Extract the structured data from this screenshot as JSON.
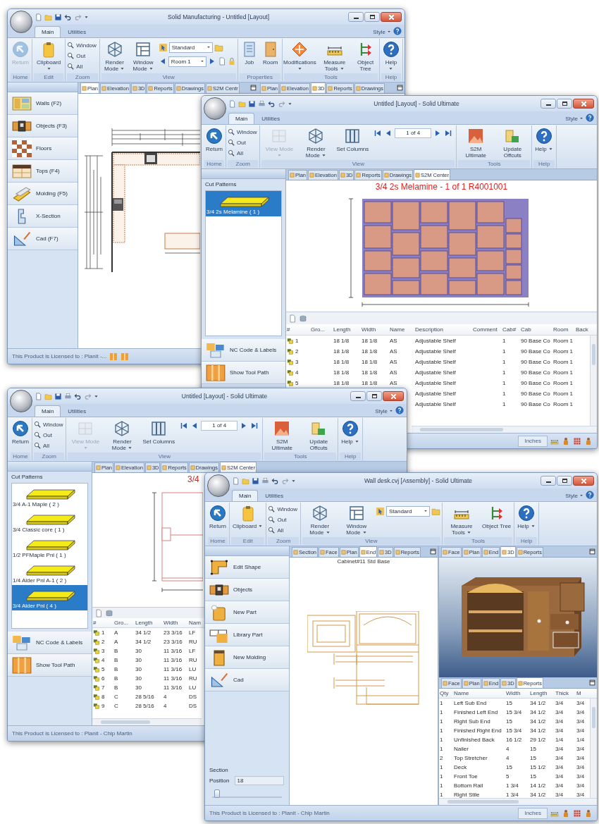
{
  "windows": [
    {
      "kind": "plan",
      "title": "Solid Manufacturing - Untitled [Layout]",
      "ribbon_tabs": [
        {
          "label": "Main",
          "selected": true
        },
        {
          "label": "Utilities",
          "selected": false
        }
      ],
      "style_menu": "Style",
      "ribbon_groups": [
        {
          "label": "Home",
          "items": [
            {
              "kind": "large",
              "label": "Return",
              "dropdown": false,
              "disabled": true
            }
          ]
        },
        {
          "label": "Edit",
          "items": [
            {
              "kind": "large",
              "label": "Clipboard",
              "dropdown": true,
              "disabled": false
            }
          ]
        },
        {
          "label": "Zoom",
          "items": [
            {
              "kind": "stack",
              "labels": [
                "Window",
                "Out",
                "All"
              ]
            }
          ]
        },
        {
          "label": "View",
          "items": [
            {
              "kind": "large",
              "label": "Render Mode",
              "dropdown": true,
              "disabled": false
            },
            {
              "kind": "large",
              "label": "Window Mode",
              "dropdown": true,
              "disabled": false
            },
            {
              "kind": "combos",
              "combos": [
                {
                  "value": "Standard",
                  "arrows": false
                },
                {
                  "value": "Room 1",
                  "arrows": true
                }
              ]
            }
          ]
        },
        {
          "label": "Properties",
          "items": [
            {
              "kind": "large",
              "label": "Job",
              "dropdown": false,
              "disabled": false
            },
            {
              "kind": "large",
              "label": "Room",
              "dropdown": false,
              "disabled": false
            }
          ]
        },
        {
          "label": "Tools",
          "items": [
            {
              "kind": "large",
              "label": "Modifications",
              "dropdown": true,
              "disabled": false
            },
            {
              "kind": "large",
              "label": "Measure Tools",
              "dropdown": true,
              "disabled": false
            },
            {
              "kind": "large",
              "label": "Object Tree",
              "dropdown": false,
              "disabled": false
            }
          ]
        },
        {
          "label": "Help",
          "items": [
            {
              "kind": "large",
              "label": "Help",
              "dropdown": true,
              "disabled": false
            }
          ]
        }
      ],
      "tools": [
        "Walls (F2)",
        "Objects (F3)",
        "Floors",
        "Tops (F4)",
        "Molding (F5)",
        "X-Section",
        "Cad (F7)"
      ],
      "panes": [
        {
          "tabs": [
            {
              "label": "Plan",
              "selected": true
            },
            {
              "label": "Elevation",
              "selected": false
            },
            {
              "label": "3D",
              "selected": false
            },
            {
              "label": "Reports",
              "selected": false
            },
            {
              "label": "Drawings",
              "selected": false
            },
            {
              "label": "S2M Centr",
              "selected": false
            }
          ]
        },
        {
          "tabs": [
            {
              "label": "Plan",
              "selected": false
            },
            {
              "label": "Elevation",
              "selected": false
            },
            {
              "label": "3D",
              "selected": true
            },
            {
              "label": "Reports",
              "selected": false
            },
            {
              "label": "Drawings",
              "selected": false
            }
          ]
        }
      ],
      "status": {
        "text": "This Product is Licensed to : Planit -..."
      }
    },
    {
      "kind": "cut",
      "title": "Untitled [Layout] - Solid Ultimate",
      "ribbon_tabs": [
        {
          "label": "Main",
          "selected": true
        },
        {
          "label": "Utilities",
          "selected": false
        }
      ],
      "style_menu": "Style",
      "ribbon_groups": [
        {
          "label": "Home",
          "items": [
            {
              "kind": "large",
              "label": "Return",
              "dropdown": false,
              "disabled": false
            }
          ]
        },
        {
          "label": "Zoom",
          "items": [
            {
              "kind": "stack",
              "labels": [
                "Window",
                "Out",
                "All"
              ]
            }
          ]
        },
        {
          "label": "View",
          "items": [
            {
              "kind": "large",
              "label": "View Mode",
              "dropdown": true,
              "disabled": true
            },
            {
              "kind": "large",
              "label": "Render Mode",
              "dropdown": true,
              "disabled": false
            },
            {
              "kind": "large",
              "label": "Set Columns",
              "dropdown": false,
              "disabled": false
            },
            {
              "kind": "pager",
              "value": "1 of 4"
            }
          ]
        },
        {
          "label": "Tools",
          "items": [
            {
              "kind": "large",
              "label": "S2M Ultimate",
              "dropdown": false,
              "disabled": false
            },
            {
              "kind": "large",
              "label": "Update Offcuts",
              "dropdown": false,
              "disabled": false
            }
          ]
        },
        {
          "label": "Help",
          "items": [
            {
              "kind": "large",
              "label": "Help",
              "dropdown": true,
              "disabled": false
            }
          ]
        }
      ],
      "patterns_title": "Cut Patterns",
      "patterns": [
        {
          "label": "3/4 2s Melamine ( 1 )",
          "selected": true
        }
      ],
      "tools": [
        "NC Code & Labels",
        "Show Tool Path"
      ],
      "tabs": [
        {
          "label": "Plan",
          "selected": false
        },
        {
          "label": "Elevation",
          "selected": false
        },
        {
          "label": "3D",
          "selected": false
        },
        {
          "label": "Reports",
          "selected": false
        },
        {
          "label": "Drawings",
          "selected": false
        },
        {
          "label": "S2M Center",
          "selected": true
        }
      ],
      "heading": "3/4 2s Melamine - 1 of 1 R4001001",
      "table": {
        "columns": [
          "#",
          "Gro...",
          "Length",
          "Width",
          "Name",
          "Description",
          "Comment",
          "Cab#",
          "Cab",
          "Room",
          "Back"
        ],
        "rows": [
          [
            "1",
            null,
            "18 1/8",
            "18 1/8",
            "AS",
            "Adjustable Shelf",
            null,
            "1",
            "90 Base Co",
            "Room 1",
            null
          ],
          [
            "2",
            null,
            "18 1/8",
            "18 1/8",
            "AS",
            "Adjustable Shelf",
            null,
            "1",
            "90 Base Co",
            "Room 1",
            null
          ],
          [
            "3",
            null,
            "18 1/8",
            "18 1/8",
            "AS",
            "Adjustable Shelf",
            null,
            "1",
            "90 Base Co",
            "Room 1",
            null
          ],
          [
            "4",
            null,
            "18 1/8",
            "18 1/8",
            "AS",
            "Adjustable Shelf",
            null,
            "1",
            "90 Base Co",
            "Room 1",
            null
          ],
          [
            "5",
            null,
            "18 1/8",
            "18 1/8",
            "AS",
            "Adjustable Shelf",
            null,
            "1",
            "90 Base Co",
            "Room 1",
            null
          ],
          [
            null,
            null,
            null,
            null,
            null,
            "Adjustable Shelf",
            null,
            "1",
            "90 Base Co",
            "Room 1",
            null
          ],
          [
            null,
            null,
            null,
            null,
            null,
            "Adjustable Shelf",
            null,
            "1",
            "90 Base Co",
            "Room 1",
            null
          ]
        ]
      },
      "status": {
        "units": "Inches"
      }
    },
    {
      "kind": "cut",
      "title": "Untitled [Layout] - Solid Ultimate",
      "ribbon_tabs": [
        {
          "label": "Main",
          "selected": true
        },
        {
          "label": "Utilities",
          "selected": false
        }
      ],
      "style_menu": "Style",
      "ribbon_groups": [
        {
          "label": "Home",
          "items": [
            {
              "kind": "large",
              "label": "Return",
              "dropdown": false,
              "disabled": false
            }
          ]
        },
        {
          "label": "Zoom",
          "items": [
            {
              "kind": "stack",
              "labels": [
                "Window",
                "Out",
                "All"
              ]
            }
          ]
        },
        {
          "label": "View",
          "items": [
            {
              "kind": "large",
              "label": "View Mode",
              "dropdown": true,
              "disabled": true
            },
            {
              "kind": "large",
              "label": "Render Mode",
              "dropdown": true,
              "disabled": false
            },
            {
              "kind": "large",
              "label": "Set Columns",
              "dropdown": false,
              "disabled": false
            },
            {
              "kind": "pager",
              "value": "1 of 4"
            }
          ]
        },
        {
          "label": "Tools",
          "items": [
            {
              "kind": "large",
              "label": "S2M Ultimate",
              "dropdown": false,
              "disabled": false
            },
            {
              "kind": "large",
              "label": "Update Offcuts",
              "dropdown": false,
              "disabled": false
            }
          ]
        },
        {
          "label": "Help",
          "items": [
            {
              "kind": "large",
              "label": "Help",
              "dropdown": true,
              "disabled": false
            }
          ]
        }
      ],
      "patterns_title": "Cut Patterns",
      "patterns": [
        {
          "label": "3/4 A-1 Maple ( 2 )",
          "selected": false
        },
        {
          "label": "3/4 Classic core ( 1 )",
          "selected": false
        },
        {
          "label": "1/2 PFMaple Pnl ( 1 )",
          "selected": false
        },
        {
          "label": "1/4 Alder Pnl A-1 ( 2 )",
          "selected": false
        },
        {
          "label": "3/4 Alder Pnl ( 4 )",
          "selected": true
        }
      ],
      "tools": [
        "NC Code & Labels",
        "Show Tool Path"
      ],
      "tabs": [
        {
          "label": "Plan",
          "selected": false
        },
        {
          "label": "Elevation",
          "selected": false
        },
        {
          "label": "3D",
          "selected": false
        },
        {
          "label": "Reports",
          "selected": false
        },
        {
          "label": "Drawings",
          "selected": false
        },
        {
          "label": "S2M Center",
          "selected": true
        }
      ],
      "heading": "3/4",
      "table": {
        "columns": [
          "#",
          "Gro...",
          "Length",
          "Width",
          "Nam"
        ],
        "rows": [
          [
            "1",
            "A",
            "34 1/2",
            "23 3/16",
            "LF"
          ],
          [
            "2",
            "A",
            "34 1/2",
            "23 3/16",
            "RU"
          ],
          [
            "3",
            "B",
            "30",
            "11 3/16",
            "LF"
          ],
          [
            "4",
            "B",
            "30",
            "11 3/16",
            "RU"
          ],
          [
            "5",
            "B",
            "30",
            "11 3/16",
            "LU"
          ],
          [
            "6",
            "B",
            "30",
            "11 3/16",
            "RU"
          ],
          [
            "7",
            "B",
            "30",
            "11 3/16",
            "LU"
          ],
          [
            "8",
            "C",
            "28 5/16",
            "4",
            "DS"
          ],
          [
            "9",
            "C",
            "28 5/16",
            "4",
            "DS"
          ]
        ]
      },
      "status": {
        "text": "This Product is Licensed to : Planit - Chip Martin"
      }
    },
    {
      "kind": "assembly",
      "title": "Wall desk.cvj [Assembly] - Solid Ultimate",
      "ribbon_tabs": [
        {
          "label": "Main",
          "selected": true
        },
        {
          "label": "Utilities",
          "selected": false
        }
      ],
      "style_menu": "Style",
      "ribbon_groups": [
        {
          "label": "Home",
          "items": [
            {
              "kind": "large",
              "label": "Return",
              "dropdown": false,
              "disabled": false
            }
          ]
        },
        {
          "label": "Edit",
          "items": [
            {
              "kind": "large",
              "label": "Clipboard",
              "dropdown": true,
              "disabled": false
            }
          ]
        },
        {
          "label": "Zoom",
          "items": [
            {
              "kind": "stack",
              "labels": [
                "Window",
                "Out",
                "All"
              ]
            }
          ]
        },
        {
          "label": "View",
          "items": [
            {
              "kind": "large",
              "label": "Render Mode",
              "dropdown": true,
              "disabled": false
            },
            {
              "kind": "large",
              "label": "Window Mode",
              "dropdown": true,
              "disabled": false
            },
            {
              "kind": "combos",
              "combos": [
                {
                  "value": "Standard",
                  "arrows": false
                }
              ]
            }
          ]
        },
        {
          "label": "Tools",
          "items": [
            {
              "kind": "large",
              "label": "Measure Tools",
              "dropdown": true,
              "disabled": false
            },
            {
              "kind": "large",
              "label": "Object Tree",
              "dropdown": false,
              "disabled": false
            }
          ]
        },
        {
          "label": "Help",
          "items": [
            {
              "kind": "large",
              "label": "Help",
              "dropdown": true,
              "disabled": false
            }
          ]
        }
      ],
      "tools": [
        "Edit Shape",
        "Objects",
        "New Part",
        "Library Part",
        "New Molding",
        "Cad"
      ],
      "section": {
        "title": "Section",
        "label": "Position",
        "value": "18",
        "level": 0.03
      },
      "panes": [
        {
          "tabs": [
            {
              "label": "Section",
              "selected": false
            },
            {
              "label": "Face",
              "selected": false
            },
            {
              "label": "Plan",
              "selected": false
            },
            {
              "label": "End",
              "selected": true
            },
            {
              "label": "3D",
              "selected": false
            },
            {
              "label": "Reports",
              "selected": false
            }
          ],
          "caption": "Cabinet#11 Std Base"
        },
        {
          "tabs": [
            {
              "label": "Face",
              "selected": false
            },
            {
              "label": "Plan",
              "selected": false
            },
            {
              "label": "End",
              "selected": false
            },
            {
              "label": "3D",
              "selected": true
            },
            {
              "label": "Reports",
              "selected": false
            }
          ]
        },
        {
          "tabs": [
            {
              "label": "Face",
              "selected": false
            },
            {
              "label": "Plan",
              "selected": false
            },
            {
              "label": "End",
              "selected": false
            },
            {
              "label": "3D",
              "selected": false
            },
            {
              "label": "Reports",
              "selected": true
            }
          ],
          "table": {
            "columns": [
              "Qty",
              "Name",
              "Width",
              "Length",
              "Thick",
              "M"
            ],
            "rows": [
              [
                "1",
                "Left Sub End",
                "15",
                "34 1/2",
                "3/4",
                "3/4"
              ],
              [
                "1",
                "Finished Left End",
                "15 3/4",
                "34 1/2",
                "3/4",
                "3/4"
              ],
              [
                "1",
                "Right Sub End",
                "15",
                "34 1/2",
                "3/4",
                "3/4"
              ],
              [
                "1",
                "Finished Right End",
                "15 3/4",
                "34 1/2",
                "3/4",
                "3/4"
              ],
              [
                "1",
                "Unfinished Back",
                "16 1/2",
                "29 1/2",
                "1/4",
                "1/4"
              ],
              [
                "1",
                "Nailer",
                "4",
                "15",
                "3/4",
                "3/4"
              ],
              [
                "2",
                "Top Stretcher",
                "4",
                "15",
                "3/4",
                "3/4"
              ],
              [
                "1",
                "Deck",
                "15",
                "15 1/2",
                "3/4",
                "3/4"
              ],
              [
                "1",
                "Front Toe",
                "5",
                "15",
                "3/4",
                "3/4"
              ],
              [
                "1",
                "Bottom Rail",
                "1 3/4",
                "14 1/2",
                "3/4",
                "3/4"
              ],
              [
                "1",
                "Right Stile",
                "1 3/4",
                "34 1/2",
                "3/4",
                "3/4"
              ]
            ]
          }
        }
      ],
      "status": {
        "text": "This Product is Licensed to : Planit - Chip Martin",
        "units": "Inches"
      }
    }
  ]
}
